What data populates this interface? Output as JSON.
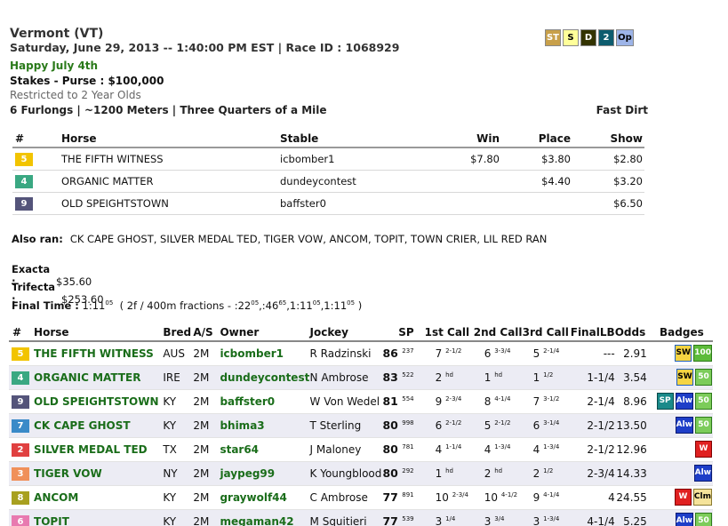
{
  "header": {
    "track": "Vermont (VT)",
    "date_line": "Saturday, June 29, 2013 -- 1:40:00 PM EST | Race ID : 1068929",
    "race_name": "Happy July 4th",
    "purse": "Stakes - Purse : $100,000",
    "restriction": "Restricted to 2 Year Olds",
    "distance": "6 Furlongs | ~1200 Meters | Three Quarters of a Mile",
    "surface": "Fast Dirt"
  },
  "top_icons": [
    {
      "label": "ST",
      "bg": "#c8a04a",
      "fg": "#ffffff"
    },
    {
      "label": "S",
      "bg": "#ffff9a",
      "fg": "#000000"
    },
    {
      "label": "D",
      "bg": "#333300",
      "fg": "#ffffff"
    },
    {
      "label": "2",
      "bg": "#0d5c6e",
      "fg": "#ffffff"
    },
    {
      "label": "Op",
      "bg": "#9db4e8",
      "fg": "#000000"
    }
  ],
  "results": {
    "headers": [
      "#",
      "Horse",
      "Stable",
      "Win",
      "Place",
      "Show"
    ],
    "rows": [
      {
        "pgm": "5",
        "pgm_bg": "#f2c400",
        "horse": "THE FIFTH WITNESS",
        "stable": "icbomber1",
        "win": "$7.80",
        "place": "$3.80",
        "show": "$2.80"
      },
      {
        "pgm": "4",
        "pgm_bg": "#3aa882",
        "horse": "ORGANIC MATTER",
        "stable": "dundeycontest",
        "win": "",
        "place": "$4.40",
        "show": "$3.20"
      },
      {
        "pgm": "9",
        "pgm_bg": "#54547a",
        "horse": "OLD SPEIGHTSTOWN",
        "stable": "baffster0",
        "win": "",
        "place": "",
        "show": "$6.50"
      }
    ]
  },
  "also_ran": {
    "label": "Also ran:",
    "text": "CK CAPE GHOST, SILVER MEDAL TED, TIGER VOW, ANCOM, TOPIT, TOWN CRIER, LIL RED RAN"
  },
  "exacta": {
    "label": "Exacta :",
    "value": "$35.60"
  },
  "trifecta": {
    "label": "Trifecta :",
    "value": "$253.60"
  },
  "final_time": {
    "label": "Final Time :",
    "time": "1:11",
    "time_sup": "05",
    "fractions_prefix": "( 2f / 400m fractions - :22",
    "f1_sup": "05",
    "f2": ",:46",
    "f2_sup": "65",
    "f3": ",1:11",
    "f3_sup": "05",
    "f4": ",1:11",
    "f4_sup": "05",
    "suffix": ")"
  },
  "field": {
    "headers": [
      "#",
      "Horse",
      "Bred",
      "A/S",
      "Owner",
      "Jockey",
      "SP",
      "1st Call",
      "2nd Call",
      "3rd Call",
      "FinalLB",
      "Odds",
      "Badges"
    ],
    "rows": [
      {
        "pgm": "5",
        "pgm_bg": "#f2c400",
        "horse": "THE FIFTH WITNESS",
        "bred": "AUS",
        "as": "2M",
        "owner": "icbomber1",
        "jockey": "R Radzinski",
        "sp": "86",
        "sp_sup": "237",
        "c1": "7",
        "c1_sup": "2-1/2",
        "c2": "6",
        "c2_sup": "3-3/4",
        "c3": "5",
        "c3_sup": "2-1/4",
        "final": "---",
        "odds": "2.91",
        "badges": [
          {
            "label": "SW",
            "bg": "#f5d442",
            "fg": "#000000",
            "border": "#2060c0"
          },
          {
            "label": "100",
            "bg": "#5dbb3a",
            "fg": "#ffffff",
            "border": "#2d7a1a"
          }
        ]
      },
      {
        "pgm": "4",
        "pgm_bg": "#3aa882",
        "horse": "ORGANIC MATTER",
        "bred": "IRE",
        "as": "2M",
        "owner": "dundeycontest",
        "jockey": "N Ambrose",
        "sp": "83",
        "sp_sup": "522",
        "c1": "2",
        "c1_sup": "hd",
        "c2": "1",
        "c2_sup": "hd",
        "c3": "1",
        "c3_sup": "1/2",
        "final": "1-1/4",
        "odds": "3.54",
        "badges": [
          {
            "label": "SW",
            "bg": "#f5d442",
            "fg": "#000000",
            "border": "#2060c0"
          },
          {
            "label": "50",
            "bg": "#7ccc5a",
            "fg": "#ffffff",
            "border": "#2d7a1a"
          }
        ]
      },
      {
        "pgm": "9",
        "pgm_bg": "#54547a",
        "horse": "OLD SPEIGHTSTOWN",
        "bred": "KY",
        "as": "2M",
        "owner": "baffster0",
        "jockey": "W Von Wedel",
        "sp": "81",
        "sp_sup": "554",
        "c1": "9",
        "c1_sup": "2-3/4",
        "c2": "8",
        "c2_sup": "4-1/4",
        "c3": "7",
        "c3_sup": "3-1/2",
        "final": "2-1/4",
        "odds": "8.96",
        "badges": [
          {
            "label": "SP",
            "bg": "#1a8a8a",
            "fg": "#ffffff",
            "border": "#0a4a4a"
          },
          {
            "label": "Alw",
            "bg": "#1e3ec8",
            "fg": "#ffffff",
            "border": "#0a1a70"
          },
          {
            "label": "50",
            "bg": "#7ccc5a",
            "fg": "#ffffff",
            "border": "#2d7a1a"
          }
        ]
      },
      {
        "pgm": "7",
        "pgm_bg": "#3a8ac8",
        "horse": "CK CAPE GHOST",
        "bred": "KY",
        "as": "2M",
        "owner": "bhima3",
        "jockey": "T Sterling",
        "sp": "80",
        "sp_sup": "998",
        "c1": "6",
        "c1_sup": "2-1/2",
        "c2": "5",
        "c2_sup": "2-1/2",
        "c3": "6",
        "c3_sup": "3-1/4",
        "final": "2-1/2",
        "odds": "13.50",
        "badges": [
          {
            "label": "Alw",
            "bg": "#1e3ec8",
            "fg": "#ffffff",
            "border": "#0a1a70"
          },
          {
            "label": "50",
            "bg": "#7ccc5a",
            "fg": "#ffffff",
            "border": "#2d7a1a"
          }
        ]
      },
      {
        "pgm": "2",
        "pgm_bg": "#e04040",
        "horse": "SILVER MEDAL TED",
        "bred": "TX",
        "as": "2M",
        "owner": "star64",
        "jockey": "J Maloney",
        "sp": "80",
        "sp_sup": "781",
        "c1": "4",
        "c1_sup": "1-1/4",
        "c2": "4",
        "c2_sup": "1-3/4",
        "c3": "4",
        "c3_sup": "1-3/4",
        "final": "2-1/2",
        "odds": "12.96",
        "badges": [
          {
            "label": "W",
            "bg": "#e02020",
            "fg": "#ffffff",
            "border": "#800000"
          }
        ]
      },
      {
        "pgm": "3",
        "pgm_bg": "#f0905a",
        "horse": "TIGER VOW",
        "bred": "NY",
        "as": "2M",
        "owner": "jaypeg99",
        "jockey": "K Youngblood",
        "sp": "80",
        "sp_sup": "292",
        "c1": "1",
        "c1_sup": "hd",
        "c2": "2",
        "c2_sup": "hd",
        "c3": "2",
        "c3_sup": "1/2",
        "final": "2-3/4",
        "odds": "14.33",
        "badges": [
          {
            "label": "Alw",
            "bg": "#1e3ec8",
            "fg": "#ffffff",
            "border": "#0a1a70"
          }
        ]
      },
      {
        "pgm": "8",
        "pgm_bg": "#a8a020",
        "horse": "ANCOM",
        "bred": "KY",
        "as": "2M",
        "owner": "graywolf44",
        "jockey": "C Ambrose",
        "sp": "77",
        "sp_sup": "891",
        "c1": "10",
        "c1_sup": "2-3/4",
        "c2": "10",
        "c2_sup": "4-1/2",
        "c3": "9",
        "c3_sup": "4-1/4",
        "final": "4",
        "odds": "24.55",
        "badges": [
          {
            "label": "W",
            "bg": "#e02020",
            "fg": "#ffffff",
            "border": "#800000"
          },
          {
            "label": "Clm",
            "bg": "#f5e39a",
            "fg": "#000000",
            "border": "#8a7a30"
          }
        ]
      },
      {
        "pgm": "6",
        "pgm_bg": "#e87ab0",
        "horse": "TOPIT",
        "bred": "KY",
        "as": "2M",
        "owner": "megaman42",
        "jockey": "M Squitieri",
        "sp": "77",
        "sp_sup": "539",
        "c1": "3",
        "c1_sup": "1/4",
        "c2": "3",
        "c2_sup": "3/4",
        "c3": "3",
        "c3_sup": "1-3/4",
        "final": "4-1/4",
        "odds": "5.25",
        "badges": [
          {
            "label": "Alw",
            "bg": "#1e3ec8",
            "fg": "#ffffff",
            "border": "#0a1a70"
          },
          {
            "label": "50",
            "bg": "#7ccc5a",
            "fg": "#ffffff",
            "border": "#2d7a1a"
          }
        ]
      }
    ]
  }
}
